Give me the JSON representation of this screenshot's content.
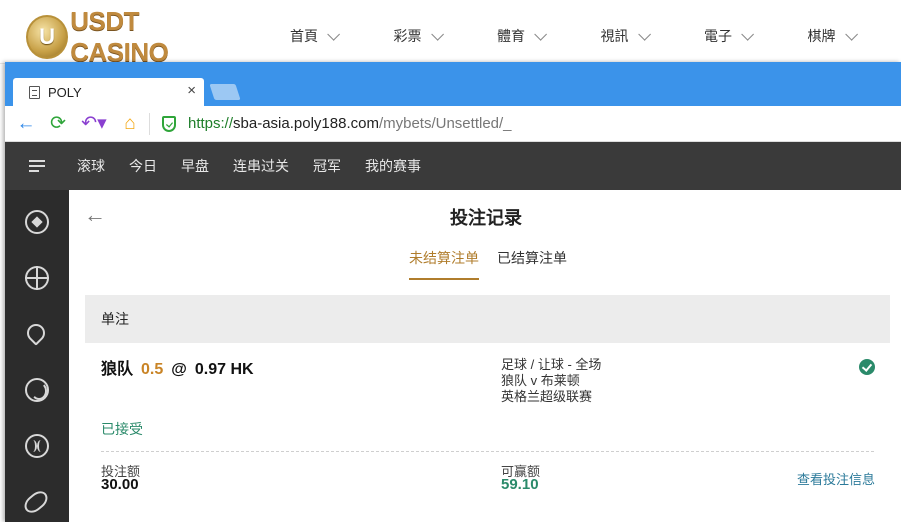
{
  "site": {
    "logo_letter": "U",
    "logo_text": "USDT CASINO",
    "nav": [
      "首頁",
      "彩票",
      "體育",
      "視訊",
      "電子",
      "棋牌"
    ]
  },
  "browser": {
    "tab_title": "POLY",
    "tab_close": "×",
    "url_scheme": "https://",
    "url_host": "sba-asia.poly188.com",
    "url_path": "/mybets/Unsettled/_"
  },
  "sportnav": [
    "滚球",
    "今日",
    "早盘",
    "连串过关",
    "冠军",
    "我的赛事"
  ],
  "sidebar_icons": [
    "soccer-icon",
    "basketball-icon",
    "tennis-icon",
    "volleyball-icon",
    "baseball-icon",
    "american-football-icon"
  ],
  "main": {
    "title": "投注记录",
    "tabs": [
      "未结算注单",
      "已结算注单"
    ],
    "section": "单注",
    "bet": {
      "selection": "狼队",
      "handicap": "0.5",
      "at": "@",
      "odds": "0.97 HK",
      "market": "足球 / 让球 - 全场",
      "match": "狼队 v 布莱顿",
      "league": "英格兰超级联赛",
      "status": "已接受",
      "stake_label": "投注额",
      "stake": "30.00",
      "return_label": "可赢额",
      "return": "59.10",
      "view_link": "查看投注信息"
    }
  },
  "colors": {
    "browser_tab_bar": "#3b93ea",
    "sport_nav": "#3a3a3a",
    "sidebar": "#2c2c2c",
    "accent_gold": "#b07d2c",
    "accept_green": "#2a8a6a"
  }
}
